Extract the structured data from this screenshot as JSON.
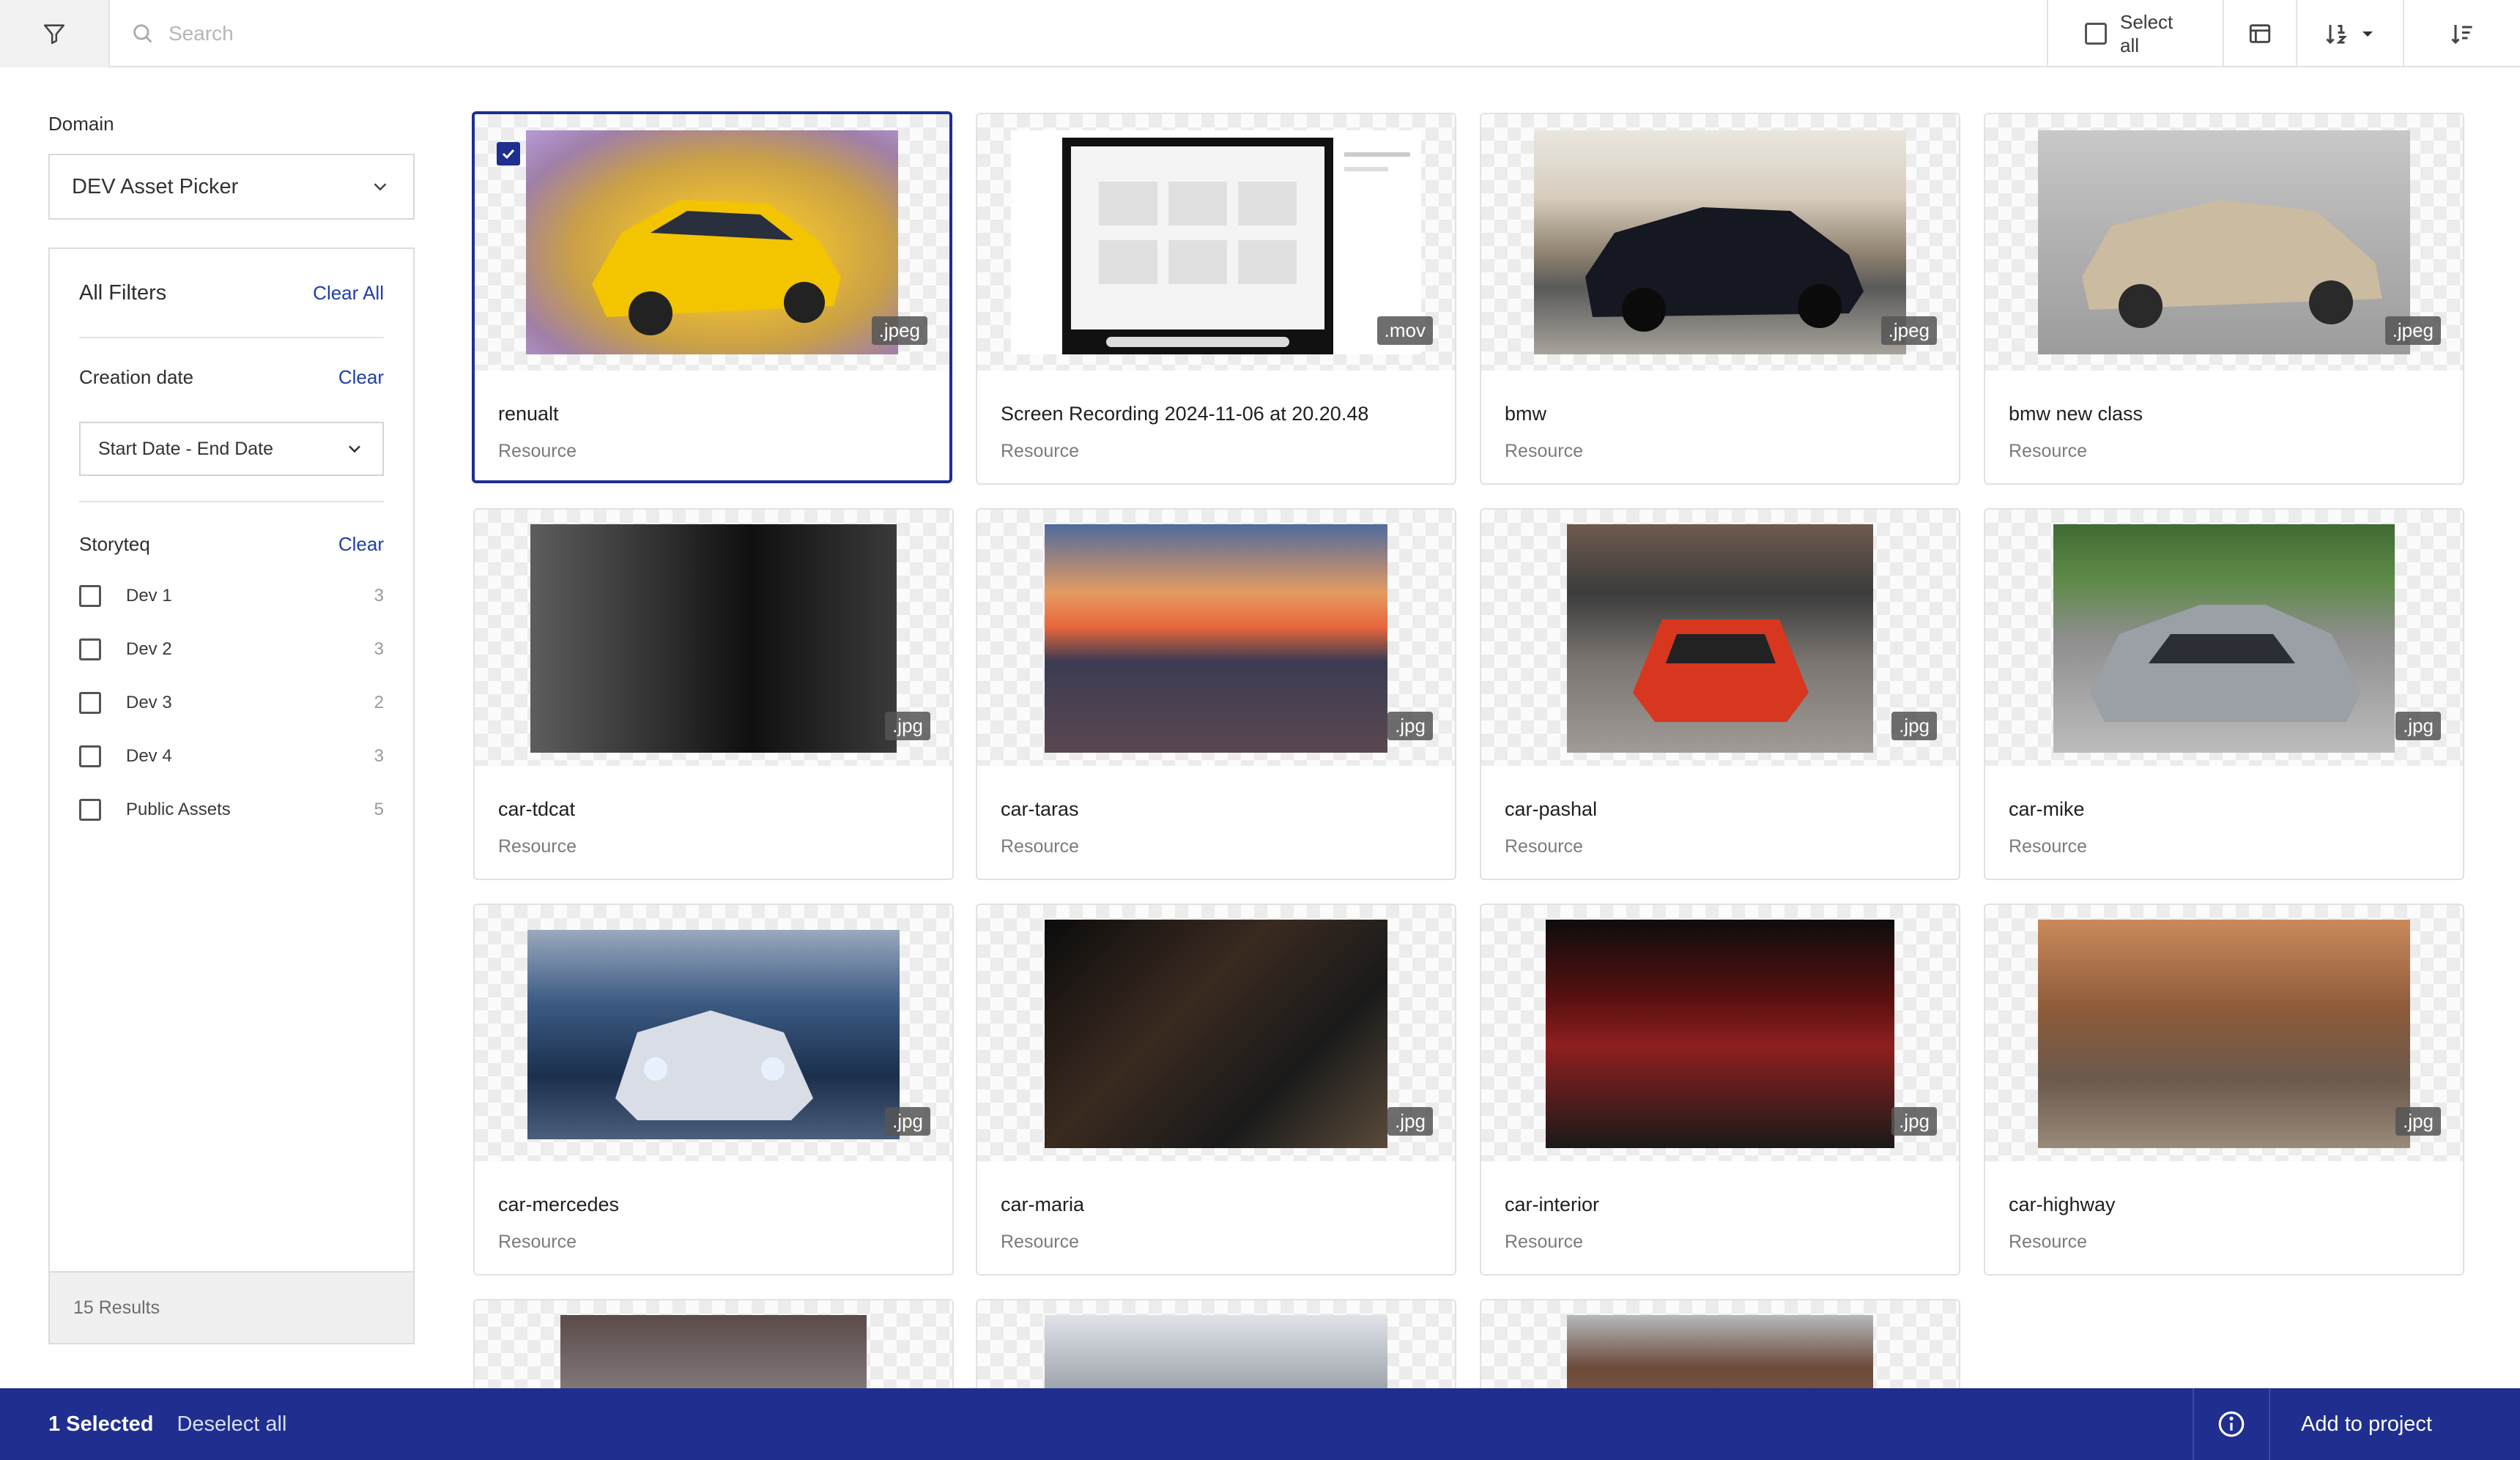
{
  "toolbar": {
    "search_placeholder": "Search",
    "select_all_label": "Select all"
  },
  "sidebar": {
    "domain_label": "Domain",
    "domain_value": "DEV Asset Picker",
    "all_filters_title": "All Filters",
    "clear_all_label": "Clear All",
    "creation_date": {
      "label": "Creation date",
      "clear_label": "Clear",
      "value": "Start Date - End Date"
    },
    "storyteq": {
      "label": "Storyteq",
      "clear_label": "Clear",
      "items": [
        {
          "name": "Dev 1",
          "count": "3"
        },
        {
          "name": "Dev 2",
          "count": "3"
        },
        {
          "name": "Dev 3",
          "count": "2"
        },
        {
          "name": "Dev 4",
          "count": "3"
        },
        {
          "name": "Public Assets",
          "count": "5"
        }
      ]
    },
    "results_text": "15 Results"
  },
  "assets": [
    {
      "title": "renualt",
      "subtitle": "Resource",
      "ext": ".jpeg",
      "selected": true
    },
    {
      "title": "Screen Recording 2024-11-06 at 20.20.48",
      "subtitle": "Resource",
      "ext": ".mov",
      "selected": false
    },
    {
      "title": "bmw",
      "subtitle": "Resource",
      "ext": ".jpeg",
      "selected": false
    },
    {
      "title": "bmw new class",
      "subtitle": "Resource",
      "ext": ".jpeg",
      "selected": false
    },
    {
      "title": "car-tdcat",
      "subtitle": "Resource",
      "ext": ".jpg",
      "selected": false
    },
    {
      "title": "car-taras",
      "subtitle": "Resource",
      "ext": ".jpg",
      "selected": false
    },
    {
      "title": "car-pashal",
      "subtitle": "Resource",
      "ext": ".jpg",
      "selected": false
    },
    {
      "title": "car-mike",
      "subtitle": "Resource",
      "ext": ".jpg",
      "selected": false
    },
    {
      "title": "car-mercedes",
      "subtitle": "Resource",
      "ext": ".jpg",
      "selected": false
    },
    {
      "title": "car-maria",
      "subtitle": "Resource",
      "ext": ".jpg",
      "selected": false
    },
    {
      "title": "car-interior",
      "subtitle": "Resource",
      "ext": ".jpg",
      "selected": false
    },
    {
      "title": "car-highway",
      "subtitle": "Resource",
      "ext": ".jpg",
      "selected": false
    }
  ],
  "bottom_bar": {
    "selected_text": "1 Selected",
    "deselect_label": "Deselect all",
    "add_label": "Add to project"
  },
  "colors": {
    "accent": "#1f2e8f",
    "link": "#1f3fa8"
  }
}
